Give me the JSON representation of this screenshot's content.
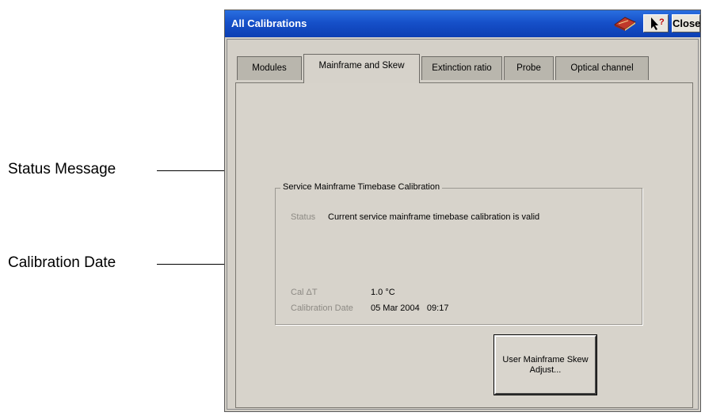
{
  "callouts": {
    "status_message": "Status Message",
    "calibration_date": "Calibration Date"
  },
  "window": {
    "title": "All Calibrations",
    "close_label": "Close",
    "icons": [
      "book-icon",
      "help-pointer-icon"
    ]
  },
  "tabs": [
    {
      "label": "Modules",
      "active": false
    },
    {
      "label": "Mainframe and Skew",
      "active": true
    },
    {
      "label": "Extinction ratio",
      "active": false
    },
    {
      "label": "Probe",
      "active": false
    },
    {
      "label": "Optical channel",
      "active": false
    }
  ],
  "group": {
    "title": "Service Mainframe Timebase Calibration",
    "status_label": "Status",
    "status_value": "Current service mainframe timebase calibration is valid",
    "cal_dt_label": "Cal ΔT",
    "cal_dt_value": "1.0 °C",
    "cal_date_label": "Calibration Date",
    "cal_date_value": "05 Mar 2004   09:17"
  },
  "user_button_label": "User Mainframe Skew\nAdjust..."
}
